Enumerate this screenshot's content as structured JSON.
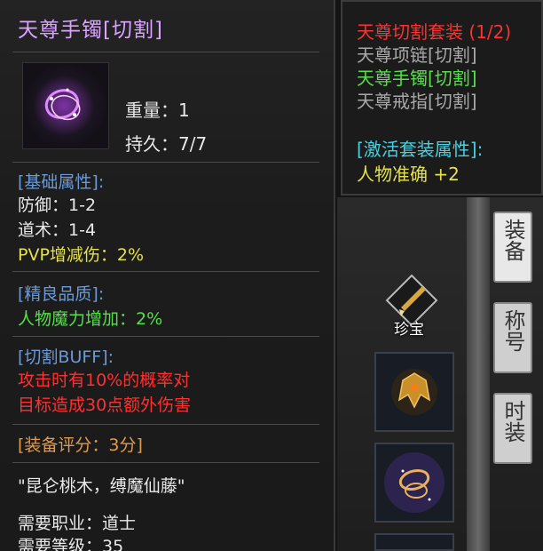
{
  "item": {
    "name": "天尊手镯[切割]",
    "weight": "重量：1",
    "durability": "持久：7/7",
    "base_header": "[基础属性]:",
    "defense": "防御：1-2",
    "taoism": "道术：1-4",
    "pvp": "PVP增减伤：2%",
    "refine_header": "[精良品质]:",
    "refine_stat": "人物魔力增加：2%",
    "buff_header": "[切割BUFF]:",
    "buff_line1": "攻击时有10%的概率对",
    "buff_line2": "目标造成30点额外伤害",
    "score": "[装备评分：3分]",
    "flavor": "\"昆仑桃木，缚魔仙藤\"",
    "req_class": "需要职业：道士",
    "req_level": "需要等级：35"
  },
  "set": {
    "title": "天尊切割套装 (1/2)",
    "pieces": [
      "天尊项链[切割]",
      "天尊手镯[切割]",
      "天尊戒指[切割]"
    ],
    "active_header": "[激活套装属性]:",
    "active_bonus": "人物准确 +2"
  },
  "side_tabs": [
    "装备",
    "称号",
    "时装"
  ],
  "treasure_label": "珍宝",
  "icons": [
    "bracelet-icon",
    "treasure-icon",
    "helmet-icon",
    "bracelet-slot-icon"
  ],
  "colors": {
    "title_purple": "#d9a3ff",
    "header_blue": "#6a9ad8",
    "pvp_yellow": "#e6e04a",
    "green": "#55e04a",
    "red": "#ff3030",
    "orange": "#e09a4a"
  }
}
